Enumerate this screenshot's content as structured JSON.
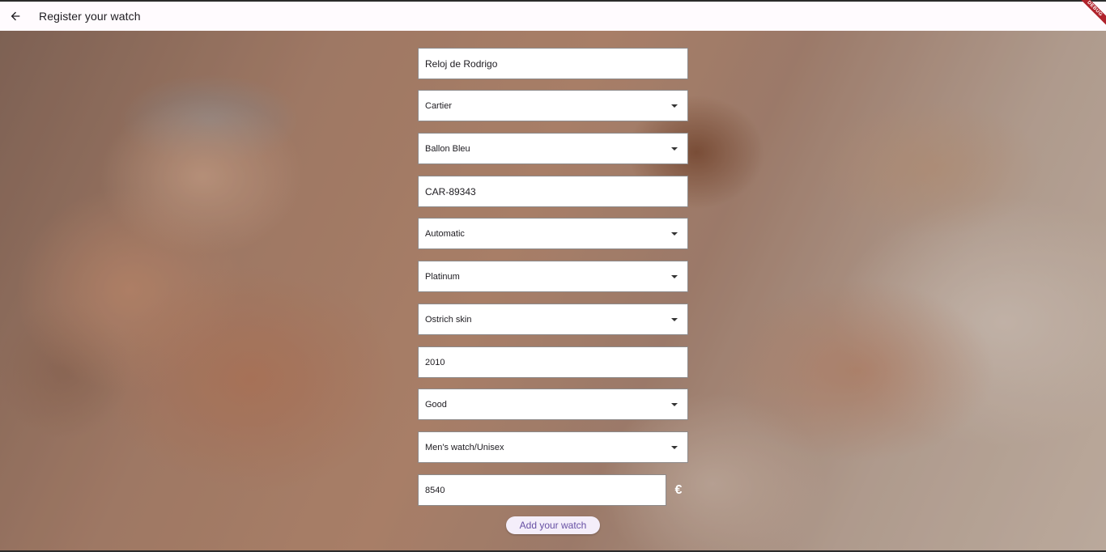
{
  "appbar": {
    "title": "Register your watch",
    "back_icon": "arrow-left-icon",
    "debug_banner": "DEBUG"
  },
  "form": {
    "watch_name": "Reloj de Rodrigo",
    "brand": "Cartier",
    "model": "Ballon Bleu",
    "reference": "CAR-89343",
    "movement": "Automatic",
    "case_material": "Platinum",
    "strap_material": "Ostrich skin",
    "year": "2010",
    "condition": "Good",
    "gender": "Men's watch/Unisex",
    "price": "8540",
    "currency": "€"
  },
  "actions": {
    "submit_label": "Add your watch"
  },
  "colors": {
    "appbar_bg": "#fffbfe",
    "button_text": "#6750a4",
    "button_bg": "#f4eefa",
    "debug_banner": "#b0232c"
  }
}
